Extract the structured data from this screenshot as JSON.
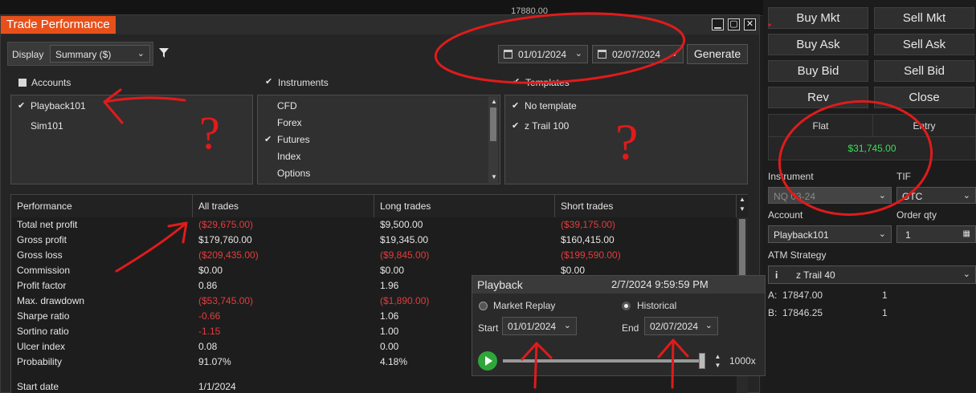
{
  "trade_performance": {
    "title": "Trade Performance",
    "display_label": "Display",
    "display_value": "Summary ($)",
    "from_date": "01/01/2024",
    "to_date": "02/07/2024",
    "generate_label": "Generate",
    "sections": {
      "accounts_label": "Accounts",
      "instruments_label": "Instruments",
      "templates_label": "Templates"
    },
    "accounts": [
      {
        "name": "Playback101",
        "checked": true
      },
      {
        "name": "Sim101",
        "checked": false
      }
    ],
    "instruments": [
      {
        "name": "CFD",
        "checked": false
      },
      {
        "name": "Forex",
        "checked": false
      },
      {
        "name": "Futures",
        "checked": true
      },
      {
        "name": "Index",
        "checked": false
      },
      {
        "name": "Options",
        "checked": false
      }
    ],
    "templates": [
      {
        "name": "No template",
        "checked": true
      },
      {
        "name": "z Trail 100",
        "checked": true
      }
    ],
    "table": {
      "headers": [
        "Performance",
        "All trades",
        "Long trades",
        "Short trades"
      ],
      "rows": [
        {
          "label": "Total net profit",
          "all": "($29,675.00)",
          "long": "$9,500.00",
          "short": "($39,175.00)"
        },
        {
          "label": "Gross profit",
          "all": "$179,760.00",
          "long": "$19,345.00",
          "short": "$160,415.00"
        },
        {
          "label": "Gross loss",
          "all": "($209,435.00)",
          "long": "($9,845.00)",
          "short": "($199,590.00)"
        },
        {
          "label": "Commission",
          "all": "$0.00",
          "long": "$0.00",
          "short": "$0.00"
        },
        {
          "label": "Profit factor",
          "all": "0.86",
          "long": "1.96",
          "short": ""
        },
        {
          "label": "Max. drawdown",
          "all": "($53,745.00)",
          "long": "($1,890.00)",
          "short": ""
        },
        {
          "label": "Sharpe ratio",
          "all": "-0.66",
          "long": "1.06",
          "short": ""
        },
        {
          "label": "Sortino ratio",
          "all": "-1.15",
          "long": "1.00",
          "short": ""
        },
        {
          "label": "Ulcer index",
          "all": "0.08",
          "long": "0.00",
          "short": ""
        },
        {
          "label": "Probability",
          "all": "91.07%",
          "long": "4.18%",
          "short": ""
        },
        {
          "label": "Start date",
          "all": "1/1/2024",
          "long": "",
          "short": ""
        }
      ]
    }
  },
  "top_strip": {
    "price": "17880.00"
  },
  "order_panel": {
    "buttons": [
      "Buy Mkt",
      "Sell Mkt",
      "Buy Ask",
      "Sell Ask",
      "Buy Bid",
      "Sell Bid",
      "Rev",
      "Close"
    ],
    "position_state": "Flat",
    "entry_label": "Entry",
    "pnl": "$31,745.00",
    "instrument_label": "Instrument",
    "instrument_value": "NQ 03-24",
    "tif_label": "TIF",
    "tif_value": "GTC",
    "account_label": "Account",
    "account_value": "Playback101",
    "order_qty_label": "Order qty",
    "order_qty_value": "1",
    "atm_label": "ATM Strategy",
    "atm_value": "z Trail 40",
    "ask_label": "A:",
    "ask_price": "17847.00",
    "ask_qty": "1",
    "bid_label": "B:",
    "bid_price": "17846.25",
    "bid_qty": "1"
  },
  "playback": {
    "title": "Playback",
    "timestamp": "2/7/2024 9:59:59 PM",
    "market_replay_label": "Market Replay",
    "historical_label": "Historical",
    "start_label": "Start",
    "start_date": "01/01/2024",
    "end_label": "End",
    "end_date": "02/07/2024",
    "speed": "1000x",
    "progress": 1.0
  },
  "annotations": {
    "question_marks": [
      "?",
      "?"
    ]
  },
  "colors": {
    "accent": "#e8501a",
    "negative": "#e23d3d",
    "positive_pnl": "#3ddc5a",
    "annotation": "#e01b1b"
  }
}
